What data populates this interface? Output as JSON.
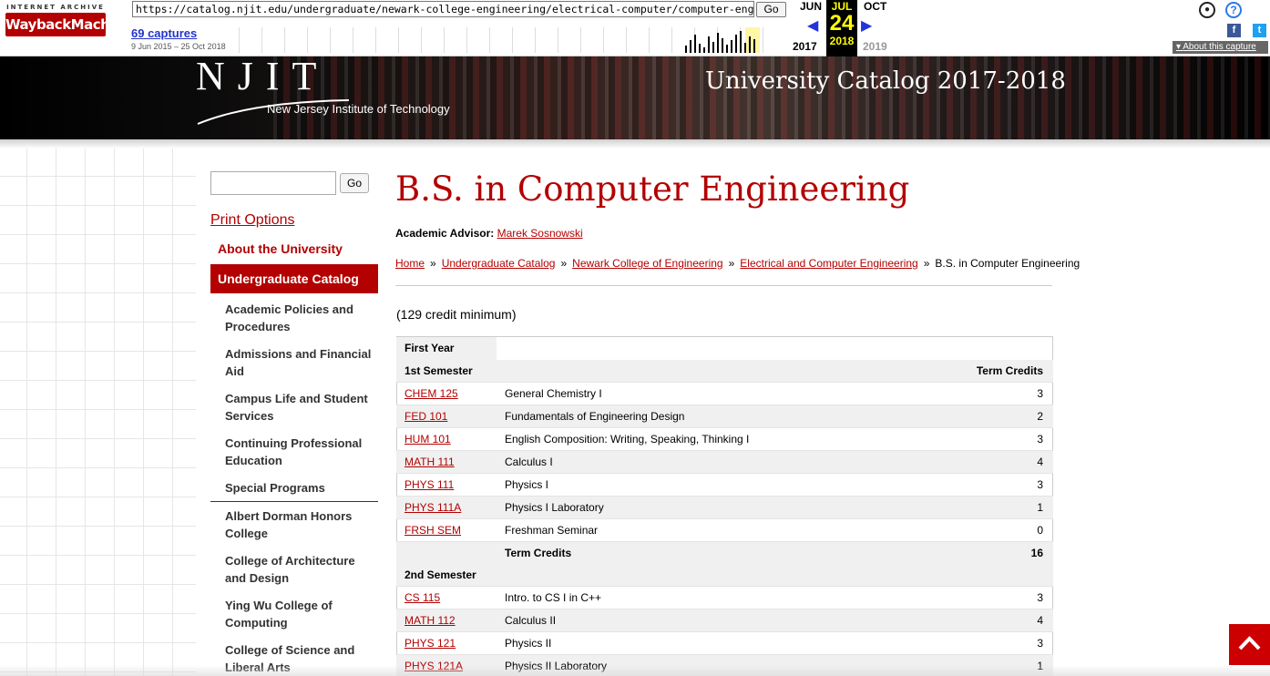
{
  "wayback": {
    "logo_top": "INTERNET ARCHIVE",
    "logo_main": "WaybackMachine",
    "url": "https://catalog.njit.edu/undergraduate/newark-college-engineering/electrical-computer/computer-engineering-b",
    "go_label": "Go",
    "captures": "69 captures",
    "range": "9 Jun 2015 – 25 Oct 2018",
    "prev_month": "JUN",
    "cur_month": "JUL",
    "next_month": "OCT",
    "cur_day": "24",
    "prev_year": "2017",
    "cur_year": "2018",
    "next_year": "2019",
    "about_capture": "About this capture",
    "highlight_color": "#ffff00"
  },
  "header": {
    "logo": "NJIT",
    "logo_subtitle": "New Jersey Institute of Technology",
    "title": "University Catalog 2017-2018"
  },
  "sidebar": {
    "search_go": "Go",
    "print": "Print Options",
    "about": "About the University",
    "active": "Undergraduate Catalog",
    "items": [
      "Academic Policies and Procedures",
      "Admissions and Financial Aid",
      "Campus Life and Student Services",
      "Continuing Professional Education",
      "Special Programs",
      "Albert Dorman Honors College",
      "College of Architecture and Design",
      "Ying Wu College of Computing",
      "College of Science and Liberal Arts"
    ]
  },
  "main": {
    "title": "B.S. in Computer Engineering",
    "advisor_label": "Academic Advisor:",
    "advisor_name": "Marek Sosnowski",
    "breadcrumb": [
      "Home",
      "Undergraduate Catalog",
      "Newark College of Engineering",
      "Electrical and Computer Engineering",
      "B.S. in Computer Engineering"
    ],
    "breadcrumb_sep": "»",
    "credits": "(129 credit minimum)",
    "year_label": "First Year",
    "sem1_label": "1st Semester",
    "term_credits_header": "Term Credits",
    "sem1_courses": [
      {
        "code": "CHEM 125",
        "title": "General Chemistry I",
        "credits": "3"
      },
      {
        "code": "FED 101",
        "title": "Fundamentals of Engineering Design",
        "credits": "2"
      },
      {
        "code": "HUM 101",
        "title": "English Composition: Writing, Speaking, Thinking I",
        "credits": "3"
      },
      {
        "code": "MATH 111",
        "title": "Calculus I",
        "credits": "4"
      },
      {
        "code": "PHYS 111",
        "title": "Physics I",
        "credits": "3"
      },
      {
        "code": "PHYS 111A",
        "title": "Physics I Laboratory",
        "credits": "1"
      },
      {
        "code": "FRSH SEM",
        "title": "Freshman Seminar",
        "credits": "0"
      }
    ],
    "sem1_total_label": "Term Credits",
    "sem1_total": "16",
    "sem2_label": "2nd Semester",
    "sem2_courses": [
      {
        "code": "CS 115",
        "title": "Intro. to CS I in C++",
        "credits": "3"
      },
      {
        "code": "MATH 112",
        "title": "Calculus II",
        "credits": "4"
      },
      {
        "code": "PHYS 121",
        "title": "Physics II",
        "credits": "3"
      },
      {
        "code": "PHYS 121A",
        "title": "Physics II Laboratory",
        "credits": "1"
      }
    ]
  },
  "colors": {
    "brand_red": "#b30000",
    "scroll_button": "#cc0000"
  },
  "icons": {
    "scroll_top": "chevron-up-icon",
    "user": "user-icon",
    "help": "help-icon",
    "facebook": "facebook-icon",
    "twitter": "twitter-icon"
  }
}
